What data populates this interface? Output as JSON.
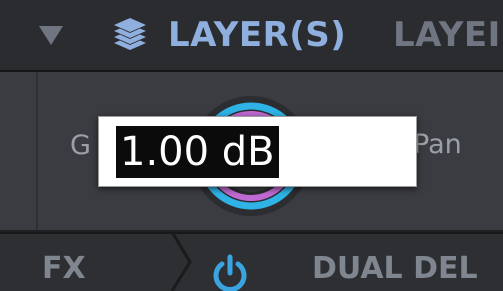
{
  "header": {
    "collapse_icon": "triangle-down-icon",
    "layers_icon": "layers-stack-icon",
    "active_tab": "LAYER(S)",
    "inactive_tab": "LAYEI"
  },
  "controls": {
    "gain_label": "G",
    "pan_label": "Pan",
    "knob_icon": "gain-knob",
    "value_field": "1.00 dB"
  },
  "fx_bar": {
    "label": "FX",
    "power_icon": "power-icon",
    "effect_name": "DUAL DEL"
  },
  "colors": {
    "accent_blue": "#8fb0df",
    "knob_ring_cyan": "#2fb3e6",
    "knob_ring_magenta": "#c06ad3",
    "power_blue": "#3aa4e0"
  }
}
